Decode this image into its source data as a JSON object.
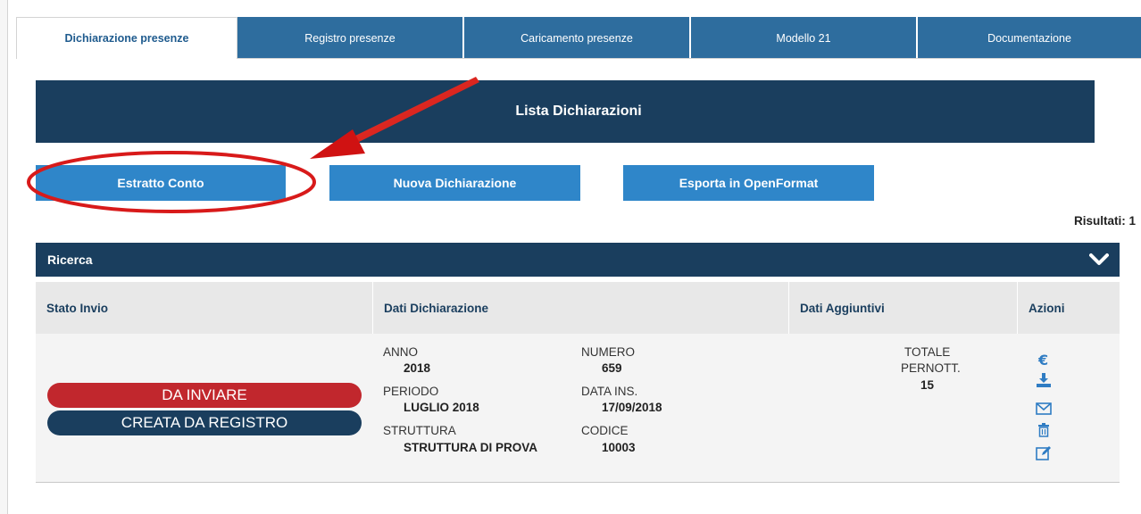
{
  "tabs": [
    {
      "label": "Dichiarazione presenze",
      "active": true
    },
    {
      "label": "Registro presenze",
      "active": false
    },
    {
      "label": "Caricamento presenze",
      "active": false
    },
    {
      "label": "Modello 21",
      "active": false
    },
    {
      "label": "Documentazione",
      "active": false
    }
  ],
  "banner": {
    "title": "Lista Dichiarazioni"
  },
  "buttons": {
    "estratto": "Estratto Conto",
    "nuova": "Nuova Dichiarazione",
    "esporta": "Esporta in OpenFormat"
  },
  "results_text": "Risultati: 1",
  "search": {
    "title": "Ricerca",
    "toggle_icon": "chevron-down-icon"
  },
  "table": {
    "headers": [
      "Stato Invio",
      "Dati Dichiarazione",
      "Dati Aggiuntivi",
      "Azioni"
    ],
    "row": {
      "status_primary": "DA INVIARE",
      "status_secondary": "CREATA DA REGISTRO",
      "anno_label": "ANNO",
      "anno": "2018",
      "periodo_label": "PERIODO",
      "periodo": "LUGLIO 2018",
      "struttura_label": "STRUTTURA",
      "struttura": "STRUTTURA DI PROVA",
      "numero_label": "NUMERO",
      "numero": "659",
      "data_label": "DATA INS.",
      "data": "17/09/2018",
      "codice_label": "CODICE",
      "codice": "10003",
      "totale_label_1": "TOTALE",
      "totale_label_2": "PERNOTT.",
      "totale": "15",
      "actions": [
        "euro-icon",
        "download-icon",
        "mail-icon",
        "trash-icon",
        "edit-icon"
      ]
    }
  },
  "colors": {
    "navy": "#1a3e5e",
    "tab_blue": "#2e6d9e",
    "button_blue": "#2f86c9",
    "status_red": "#c1272d",
    "annotation_red": "#e01b1b",
    "icon_blue": "#2f7cc3"
  }
}
